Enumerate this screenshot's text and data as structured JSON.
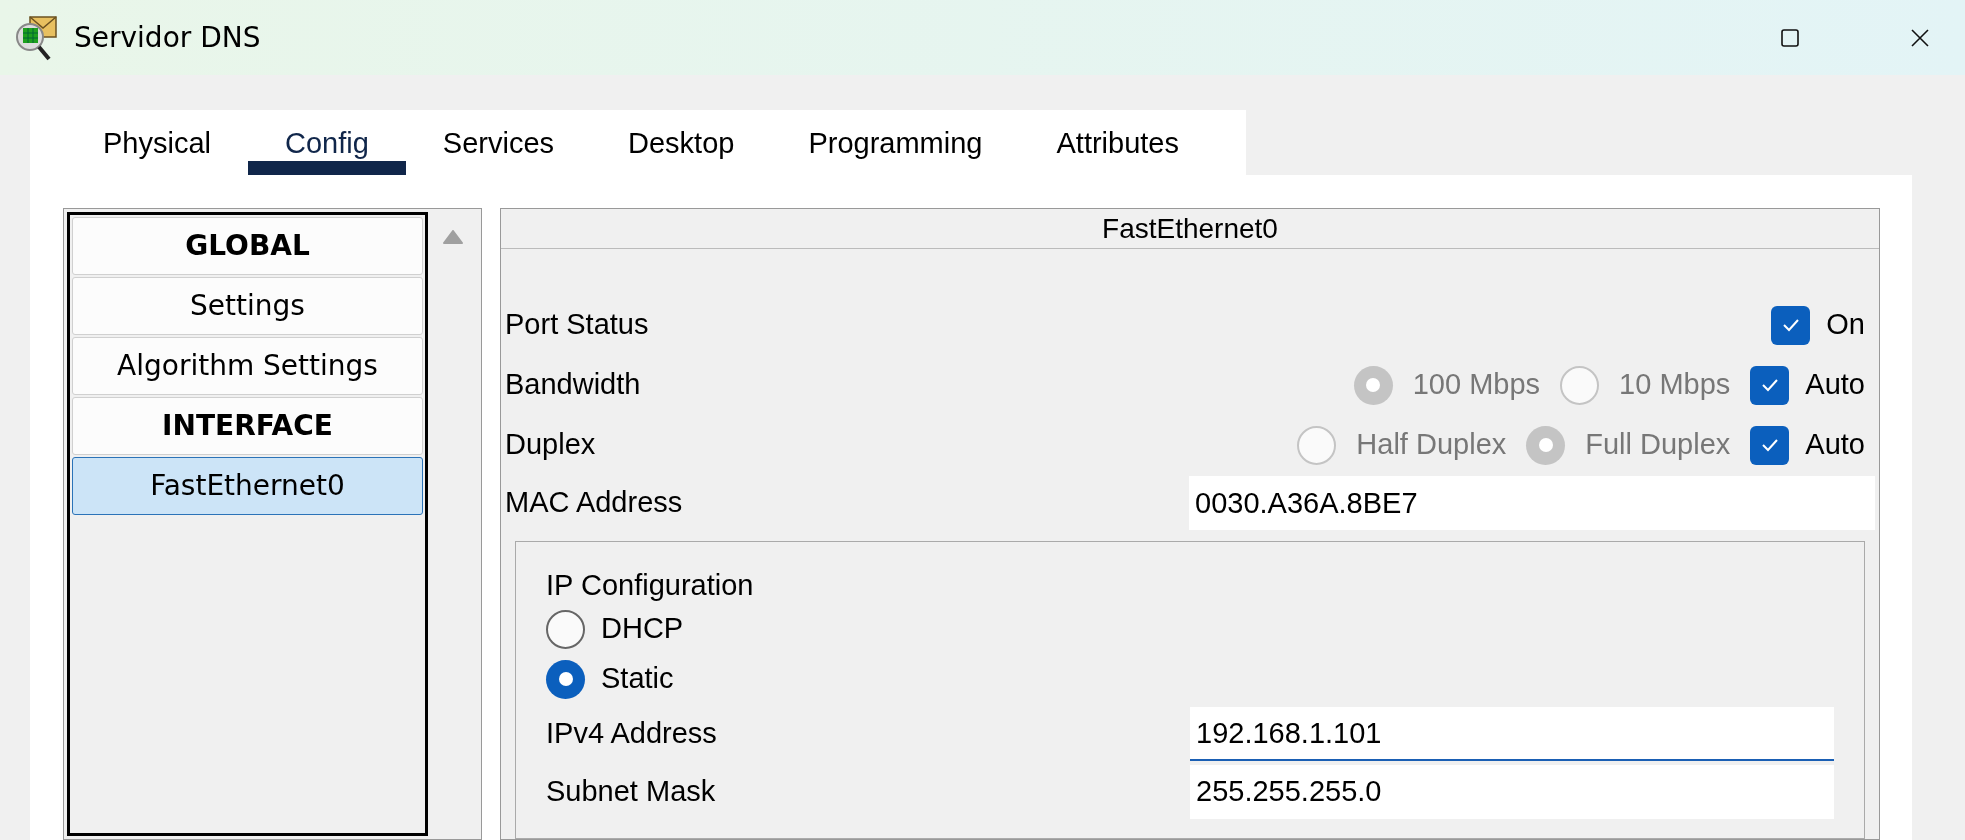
{
  "window": {
    "title": "Servidor DNS"
  },
  "tabs": [
    {
      "label": "Physical",
      "selected": false
    },
    {
      "label": "Config",
      "selected": true
    },
    {
      "label": "Services",
      "selected": false
    },
    {
      "label": "Desktop",
      "selected": false
    },
    {
      "label": "Programming",
      "selected": false
    },
    {
      "label": "Attributes",
      "selected": false
    }
  ],
  "sidebar": {
    "items": [
      {
        "label": "GLOBAL",
        "kind": "header",
        "selected": false
      },
      {
        "label": "Settings",
        "kind": "item",
        "selected": false
      },
      {
        "label": "Algorithm Settings",
        "kind": "item",
        "selected": false
      },
      {
        "label": "INTERFACE",
        "kind": "header",
        "selected": false
      },
      {
        "label": "FastEthernet0",
        "kind": "item",
        "selected": true
      }
    ]
  },
  "interface": {
    "title": "FastEthernet0",
    "port_status": {
      "label": "Port Status",
      "toggle": {
        "label": "On",
        "checked": true
      }
    },
    "bandwidth": {
      "label": "Bandwidth",
      "disabled": true,
      "options": [
        {
          "label": "100 Mbps",
          "selected": true
        },
        {
          "label": "10 Mbps",
          "selected": false
        }
      ],
      "auto": {
        "label": "Auto",
        "checked": true
      }
    },
    "duplex": {
      "label": "Duplex",
      "disabled": true,
      "options": [
        {
          "label": "Half Duplex",
          "selected": false
        },
        {
          "label": "Full Duplex",
          "selected": true
        }
      ],
      "auto": {
        "label": "Auto",
        "checked": true
      }
    },
    "mac_address": {
      "label": "MAC Address",
      "value": "0030.A36A.8BE7"
    },
    "ip_configuration": {
      "title": "IP Configuration",
      "modes": [
        {
          "label": "DHCP",
          "selected": false
        },
        {
          "label": "Static",
          "selected": true
        }
      ],
      "fields": [
        {
          "label": "IPv4 Address",
          "value": "192.168.1.101",
          "focused": true
        },
        {
          "label": "Subnet Mask",
          "value": "255.255.255.0",
          "focused": false
        }
      ]
    }
  }
}
